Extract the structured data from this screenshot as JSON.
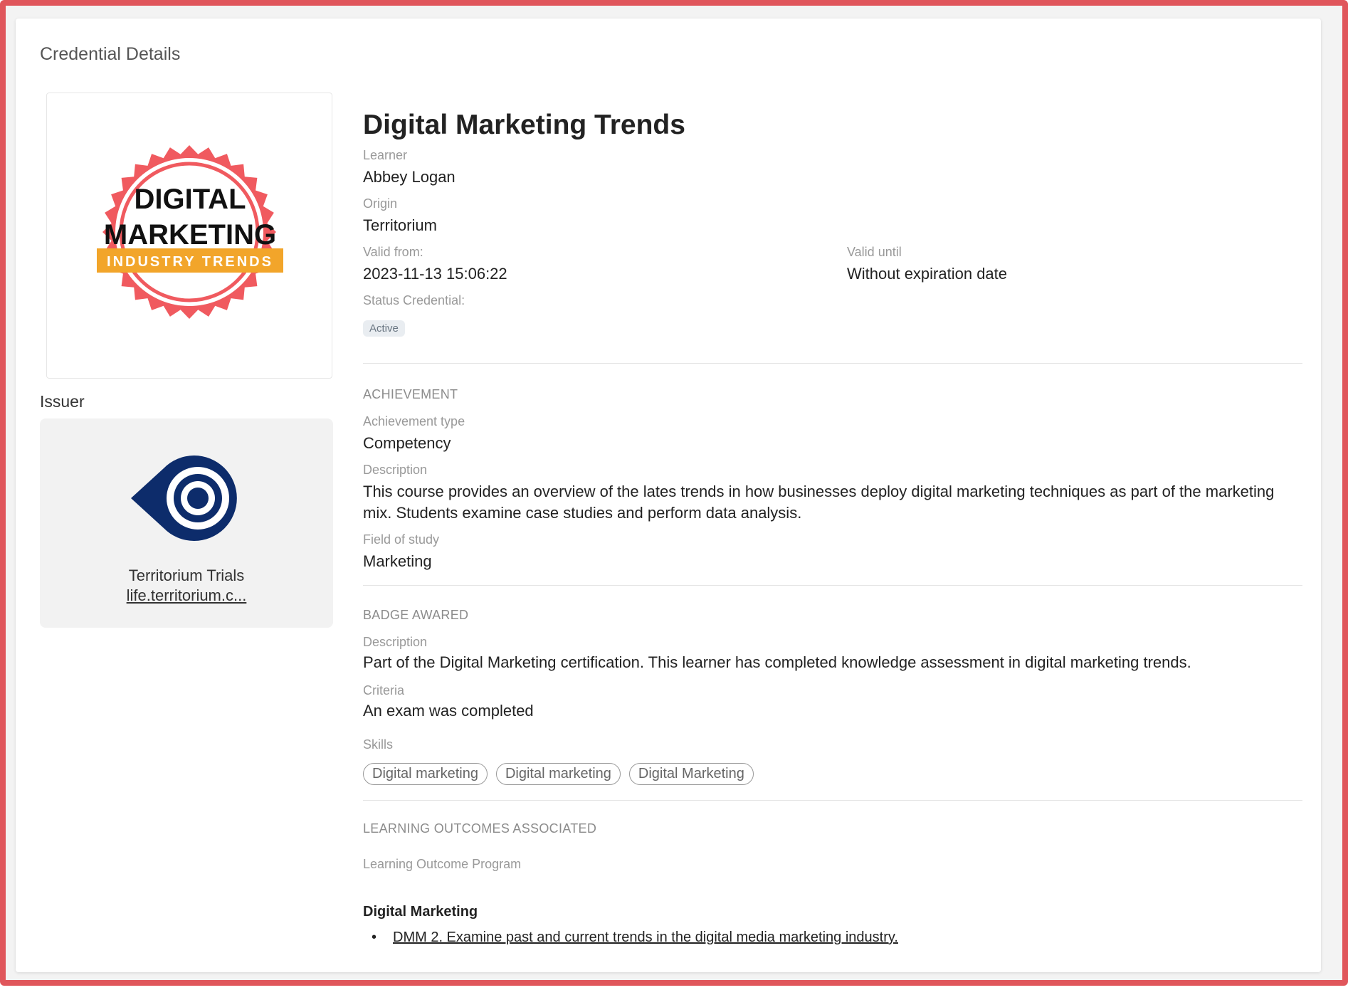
{
  "header": {
    "title": "Credential Details"
  },
  "badge": {
    "line1": "DIGITAL",
    "line2": "MARKETING",
    "ribbon": "INDUSTRY TRENDS",
    "colors": {
      "ring": "#f05a5f",
      "ribbon": "#f2a52a",
      "text": "#111111"
    }
  },
  "issuer": {
    "title": "Issuer",
    "name": "Territorium Trials",
    "link": "life.territorium.c...",
    "logo_color": "#0d2c6b"
  },
  "credential": {
    "title": "Digital Marketing Trends",
    "learner_label": "Learner",
    "learner": "Abbey Logan",
    "origin_label": "Origin",
    "origin": "Territorium",
    "valid_from_label": "Valid from:",
    "valid_from": "2023-11-13 15:06:22",
    "valid_until_label": "Valid until",
    "valid_until": "Without expiration date",
    "status_label": "Status Credential:",
    "status": "Active"
  },
  "achievement": {
    "section": "ACHIEVEMENT",
    "type_label": "Achievement type",
    "type": "Competency",
    "description_label": "Description",
    "description": "This course provides an overview of the lates trends in how businesses deploy digital marketing techniques as part of the marketing mix. Students examine case studies and perform data analysis.",
    "field_label": "Field of study",
    "field": "Marketing"
  },
  "badge_awarded": {
    "section": "BADGE AWARED",
    "description_label": "Description",
    "description": "Part of the Digital Marketing certification. This learner has completed knowledge assessment in digital marketing trends.",
    "criteria_label": "Criteria",
    "criteria": "An exam was completed",
    "skills_label": "Skills",
    "skills": [
      "Digital marketing",
      "Digital marketing",
      "Digital Marketing"
    ]
  },
  "learning_outcomes": {
    "section": "LEARNING OUTCOMES ASSOCIATED",
    "program_label": "Learning Outcome Program",
    "program": "Digital Marketing",
    "bullet": "•",
    "item": "DMM 2. Examine past and current trends in the digital media marketing industry."
  }
}
